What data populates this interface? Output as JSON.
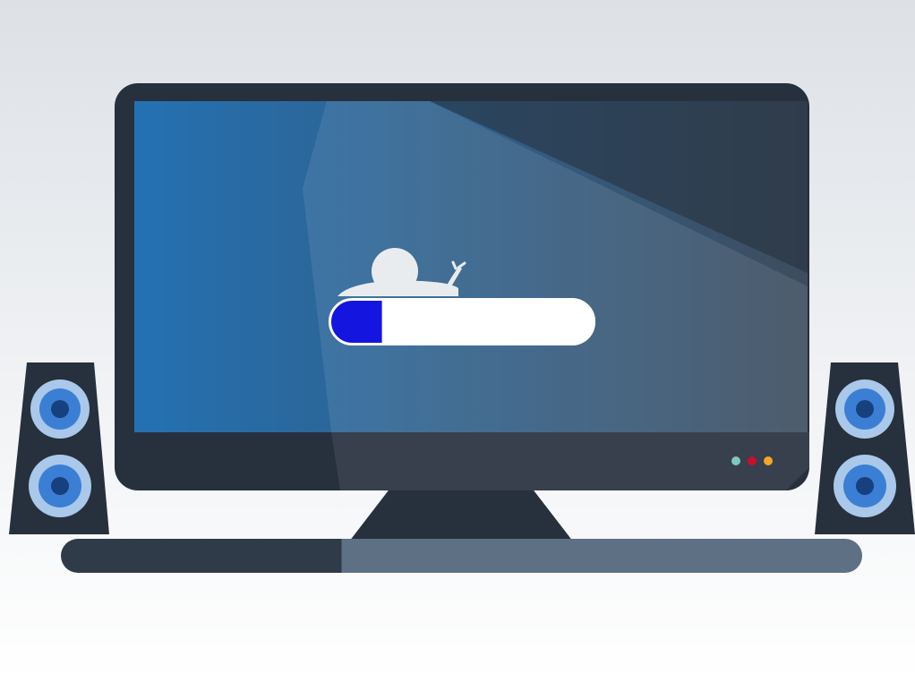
{
  "colors": {
    "background_top": "#dde1e6",
    "background_bottom": "#ffffff",
    "accent_bar": "#00aeef",
    "monitor_bezel": "#27303d",
    "screen_left": "#2471b2",
    "screen_right": "#3d4d5e",
    "light_beam": "#ffffff",
    "progress_fill": "#1515e0",
    "progress_track": "#ffffff",
    "snail": "#e9ecef",
    "speaker_body": "#27303d",
    "speaker_ring": "#a9c8ea",
    "speaker_cone": "#3b7fd4",
    "speaker_center": "#17407e",
    "stand": "#27303d",
    "base_bar_left": "#2f3b49",
    "base_bar_right": "#5e7083",
    "indicator_lights": [
      "#7ec8c1",
      "#c8102e",
      "#f5a623"
    ]
  },
  "icons": {
    "snail": "snail-icon",
    "speakers": "speaker-icon"
  },
  "progress": {
    "fraction": 0.2
  }
}
